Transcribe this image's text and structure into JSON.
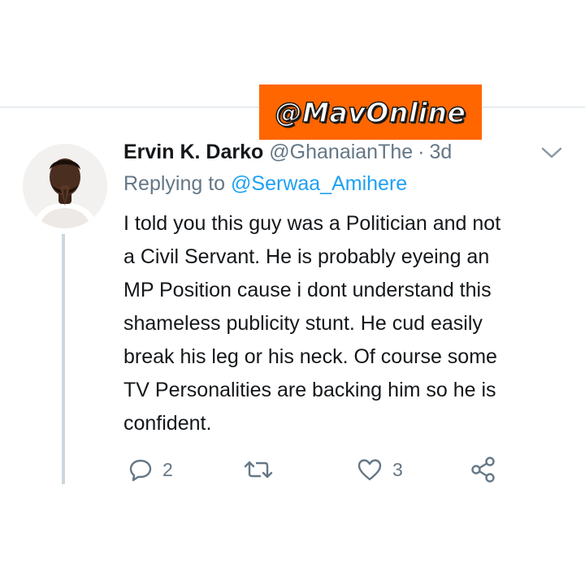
{
  "watermark": "@MavOnline",
  "tweet": {
    "display_name": "Ervin K. Darko",
    "handle": "@GhanaianThe",
    "separator": "·",
    "time": "3d",
    "replying_prefix": "Replying to",
    "replying_to": "@Serwaa_Amihere",
    "body_lines": [
      "I told you this guy was a Politician and not",
      "a Civil Servant. He is probably eyeing an",
      "MP Position cause i dont understand this",
      "shameless publicity stunt. He cud easily",
      "break his leg or his neck. Of course some",
      "TV Personalities are backing him so he is",
      "confident."
    ],
    "actions": {
      "reply_count": "2",
      "retweet_count": "",
      "like_count": "3"
    }
  },
  "icons": {
    "menu": "chevron-down-icon",
    "reply": "reply-icon",
    "retweet": "retweet-icon",
    "like": "heart-icon",
    "share": "share-icon"
  },
  "colors": {
    "watermark_bg": "#ff6600",
    "link": "#1da1f2",
    "secondary_text": "#657786",
    "primary_text": "#14171a",
    "thread_line": "#ccd6dd"
  }
}
